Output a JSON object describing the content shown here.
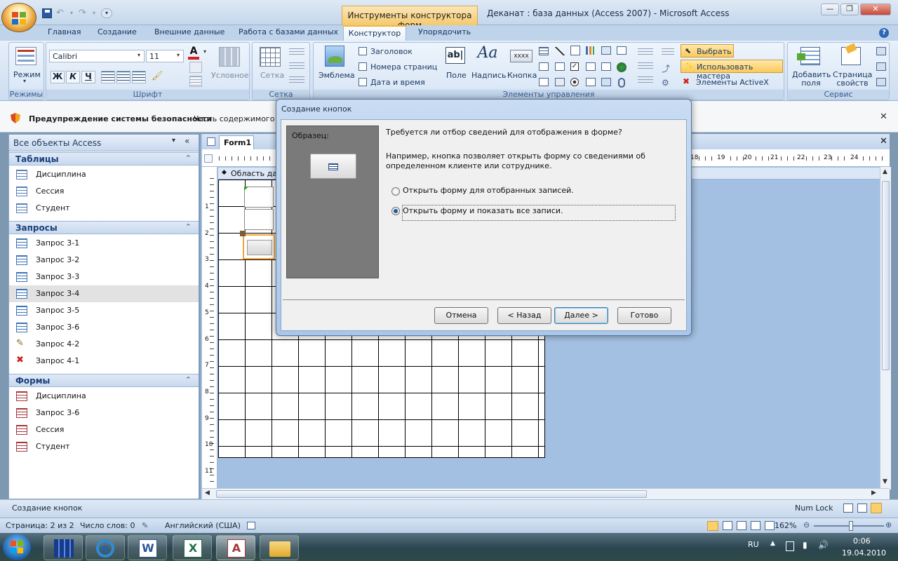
{
  "window": {
    "title": "Деканат : база данных (Access 2007) - Microsoft Access",
    "context_tab": "Инструменты конструктора форм"
  },
  "tabs": [
    {
      "label": "Главная"
    },
    {
      "label": "Создание"
    },
    {
      "label": "Внешние данные"
    },
    {
      "label": "Работа с базами данных"
    },
    {
      "label": "Конструктор"
    },
    {
      "label": "Упорядочить"
    }
  ],
  "ribbon": {
    "views": {
      "button": "Режим",
      "group": "Режимы"
    },
    "font": {
      "name": "Calibri",
      "size": "11",
      "bold": "Ж",
      "italic": "К",
      "underline": "Ч",
      "group": "Шрифт",
      "conditional": "Условное"
    },
    "grid": {
      "button": "Сетка",
      "group": "Сетка"
    },
    "controls": {
      "logo": "Эмблема",
      "title": "Заголовок",
      "page_numbers": "Номера страниц",
      "datetime": "Дата и время",
      "field": "Поле",
      "label": "Надпись",
      "button": "Кнопка",
      "sample": "xxxx",
      "ab": "ab|",
      "aa": "Aa",
      "group": "Элементы управления",
      "select": "Выбрать",
      "wizards": "Использовать мастера",
      "activex": "Элементы ActiveX"
    },
    "tools": {
      "add_field": "Добавить поля",
      "property_sheet": "Страница свойств",
      "group": "Сервис"
    }
  },
  "security": {
    "title": "Предупреждение системы безопасности",
    "text": "Часть содержимого б"
  },
  "nav": {
    "header": "Все объекты Access",
    "sections": [
      {
        "title": "Таблицы",
        "items": [
          "Дисциплина",
          "Сессия",
          "Студент"
        ]
      },
      {
        "title": "Запросы",
        "items": [
          "Запрос 3-1",
          "Запрос 3-2",
          "Запрос 3-3",
          "Запрос 3-4",
          "Запрос 3-5",
          "Запрос 3-6",
          "Запрос 4-2",
          "Запрос 4-1"
        ]
      },
      {
        "title": "Формы",
        "items": [
          "Дисциплина",
          "Запрос 3-6",
          "Сессия",
          "Студент"
        ]
      }
    ]
  },
  "document": {
    "tab": "Form1",
    "area_label": "Область данных",
    "ruler_left": [
      "1",
      "2",
      "3",
      "4",
      "5",
      "6",
      "7",
      "8",
      "9",
      "10",
      "11"
    ],
    "ruler_top": [
      "18",
      "19",
      "20",
      "21",
      "22",
      "23",
      "24"
    ]
  },
  "dialog": {
    "title": "Создание кнопок",
    "sample_label": "Образец:",
    "question": "Требуется ли отбор сведений для отображения в форме?",
    "description": "Например, кнопка позволяет открыть форму со сведениями об определенном клиенте или сотруднике.",
    "option1": "Открыть форму для отобранных записей.",
    "option2": "Открыть форму и показать все записи.",
    "selected_option": 2,
    "cancel": "Отмена",
    "back": "< Назад",
    "next": "Далее >",
    "finish": "Готово"
  },
  "status": {
    "left": "Создание кнопок",
    "numlock": "Num Lock"
  },
  "word_status": {
    "page": "Страница: 2 из 2",
    "words": "Число слов: 0",
    "language": "Английский (США)",
    "zoom": "162%"
  },
  "taskbar": {
    "lang": "RU",
    "time": "0:06",
    "date": "19.04.2010"
  },
  "colors": {
    "accent": "#f5c96c",
    "ribbon": "#dde9f7",
    "nav_header": "#1a3f7a"
  }
}
